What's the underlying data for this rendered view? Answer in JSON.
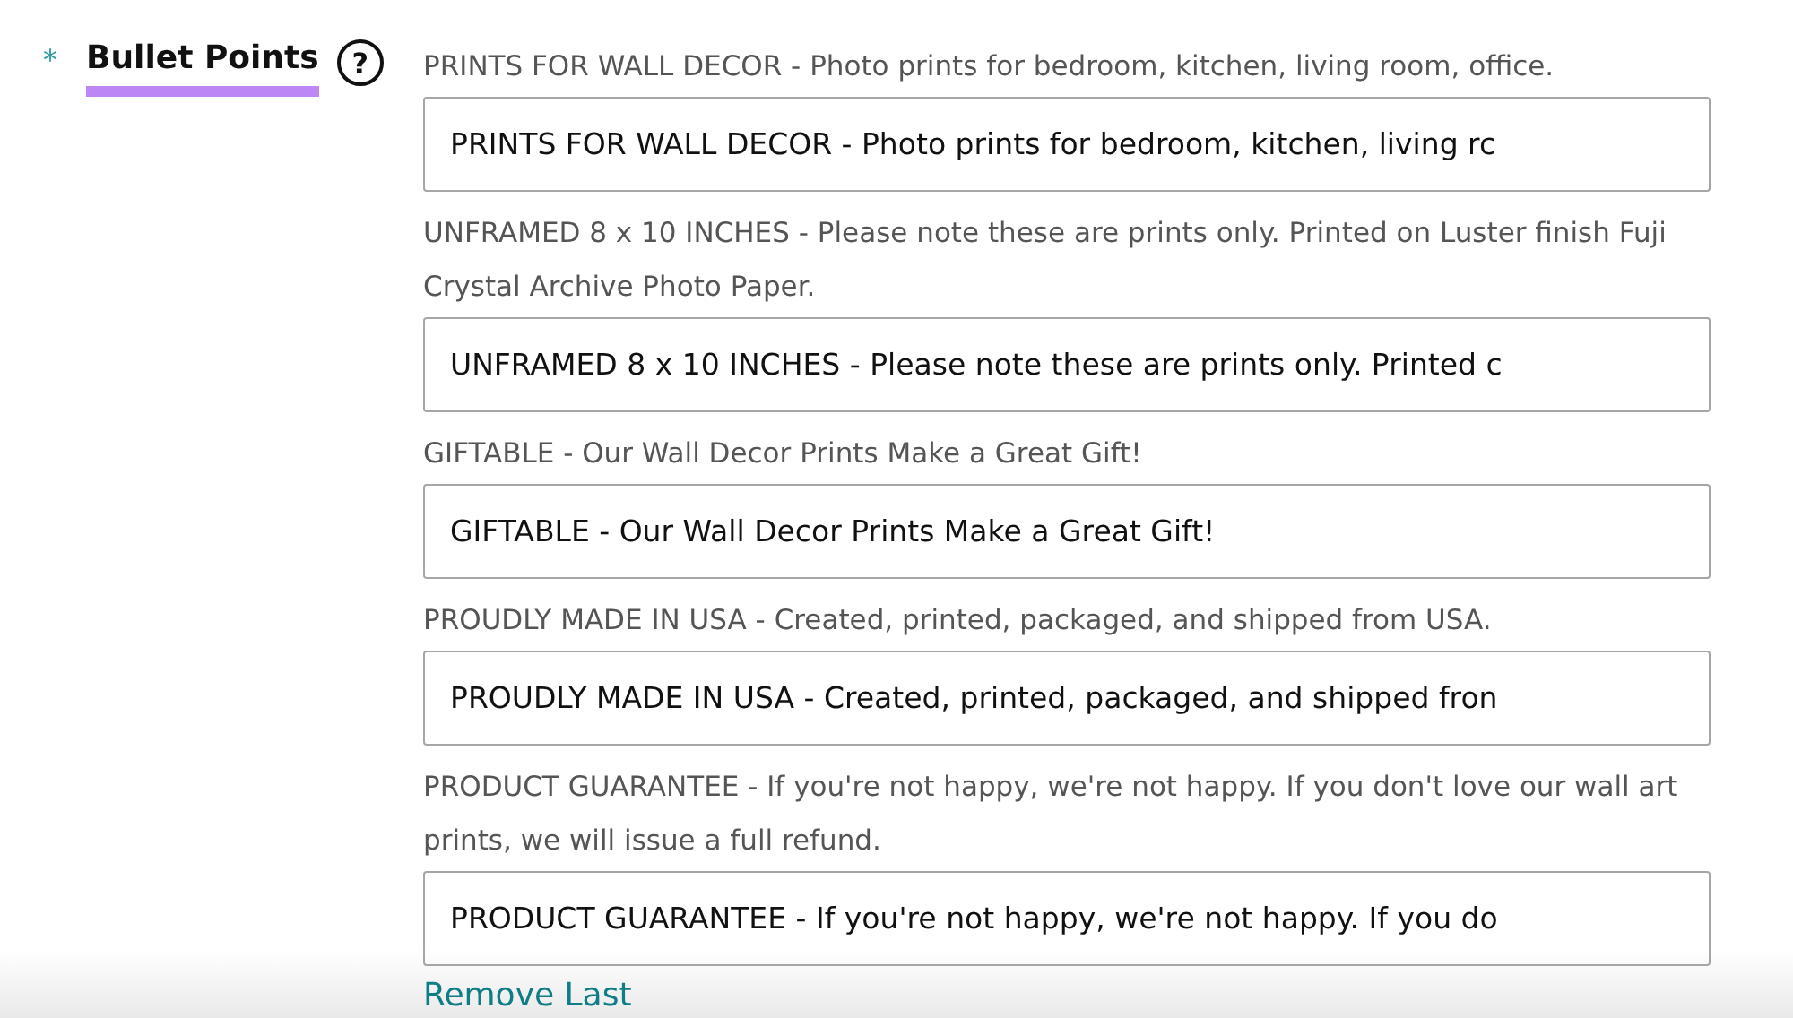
{
  "field": {
    "required_mark": "*",
    "label": "Bullet Points",
    "help_icon": "?"
  },
  "bullets": [
    {
      "hint": "PRINTS FOR WALL DECOR - Photo prints for bedroom, kitchen, living room, office.",
      "value": "PRINTS FOR WALL DECOR - Photo prints for bedroom, kitchen, living rc"
    },
    {
      "hint": "UNFRAMED 8 x 10 INCHES - Please note these are prints only. Printed on Luster finish Fuji Crystal Archive Photo Paper.",
      "value": "UNFRAMED 8 x 10 INCHES - Please note these are prints only. Printed c"
    },
    {
      "hint": "GIFTABLE - Our Wall Decor Prints Make a Great Gift!",
      "value": "GIFTABLE - Our Wall Decor Prints Make a Great Gift!"
    },
    {
      "hint": "PROUDLY MADE IN USA - Created, printed, packaged, and shipped from USA.",
      "value": "PROUDLY MADE IN USA - Created, printed, packaged, and shipped fron"
    },
    {
      "hint": "PRODUCT GUARANTEE - If you're not happy, we're not happy. If you don't love our wall art prints, we will issue a full refund.",
      "value": "PRODUCT GUARANTEE - If you're not happy, we're not happy. If you do"
    }
  ],
  "remove_link": "Remove Last"
}
